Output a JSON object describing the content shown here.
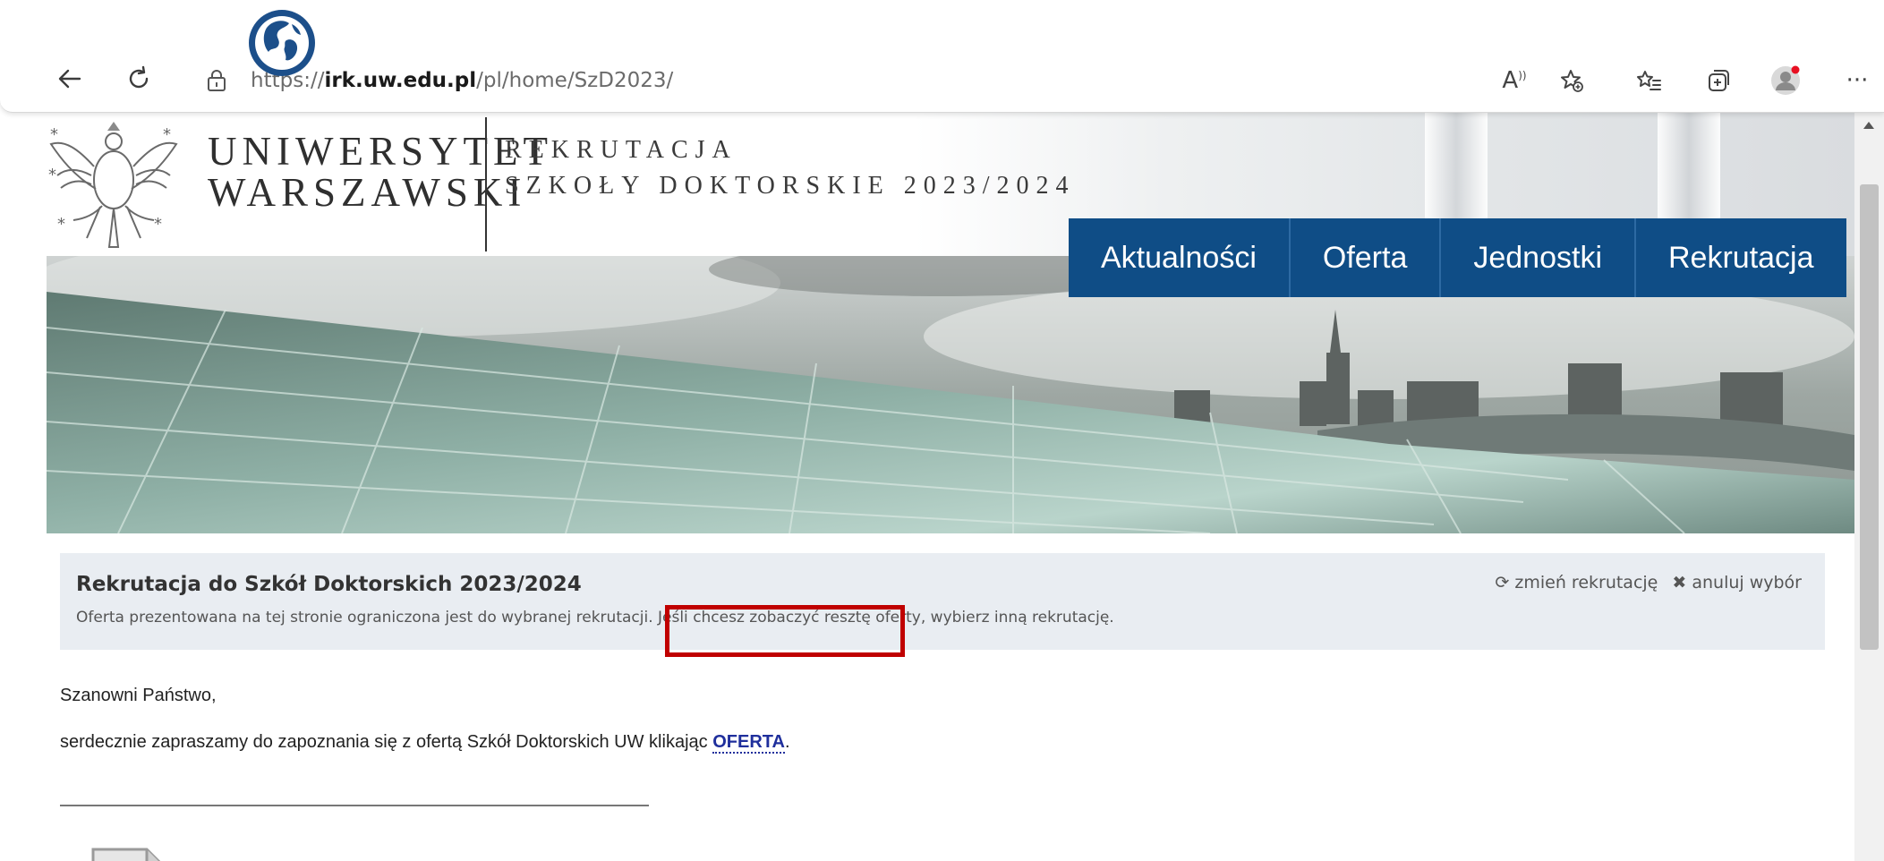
{
  "browser": {
    "url_prefix": "https://",
    "url_domain": "irk.uw.edu.pl",
    "url_path": "/pl/home/SzD2023/",
    "back_icon": "arrow-left-icon",
    "refresh_icon": "refresh-icon",
    "read_aloud_label": "A͡",
    "more_label": "···"
  },
  "header": {
    "uni_line1": "UNIWERSYTET",
    "uni_line2": "WARSZAWSKI",
    "rek_line1": "REKRUTACJA",
    "rek_line2": "SZKOŁY DOKTORSKIE 2023/2024"
  },
  "nav": {
    "items": [
      {
        "label": "Aktualności"
      },
      {
        "label": "Oferta"
      },
      {
        "label": "Jednostki"
      },
      {
        "label": "Rekrutacja"
      }
    ]
  },
  "info": {
    "title": "Rekrutacja do Szkół Doktorskich 2023/2024",
    "description": "Oferta prezentowana na tej stronie ograniczona jest do wybranej rekrutacji. Jeśli chcesz zobaczyć resztę oferty, wybierz inną rekrutację.",
    "change_label": "zmień rekrutację",
    "cancel_label": "anuluj wybór"
  },
  "content": {
    "greeting": "Szanowni Państwo,",
    "paragraph_prefix": "serdecznie zapraszamy do zapoznania się z ofertą Szkół Doktorskich UW klikając ",
    "link_label": "OFERTA",
    "paragraph_suffix": "."
  },
  "colors": {
    "nav_blue": "#0f4d86",
    "highlight_red": "#c00000",
    "link_blue": "#1f2f9c",
    "info_bg": "#e9edf2"
  }
}
